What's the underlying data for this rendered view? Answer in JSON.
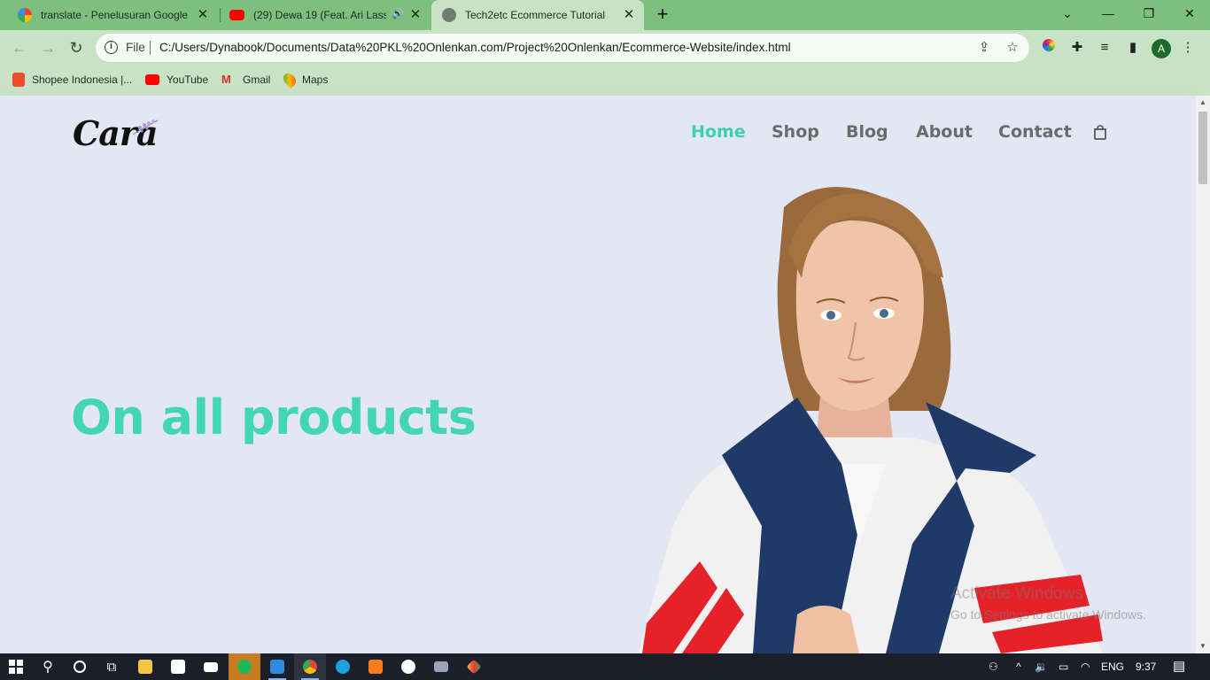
{
  "browser": {
    "tabs": [
      {
        "title": "translate - Penelusuran Google",
        "favicon": "google-icon"
      },
      {
        "title": "(29) Dewa 19 (Feat. Ari Lasso",
        "favicon": "youtube-icon"
      },
      {
        "title": "Tech2etc Ecommerce Tutorial",
        "favicon": "globe-icon"
      }
    ],
    "address": {
      "scheme": "File",
      "url": "C:/Users/Dynabook/Documents/Data%20PKL%20Onlenkan.com/Project%20Onlenkan/Ecommerce-Website/index.html"
    },
    "avatar_letter": "A",
    "bookmarks": [
      {
        "label": "Shopee Indonesia |...",
        "icon": "shopee-icon"
      },
      {
        "label": "YouTube",
        "icon": "youtube-icon"
      },
      {
        "label": "Gmail",
        "icon": "gmail-icon"
      },
      {
        "label": "Maps",
        "icon": "maps-icon"
      }
    ]
  },
  "site": {
    "logo_text": "Cara",
    "nav": [
      {
        "label": "Home",
        "active": true
      },
      {
        "label": "Shop",
        "active": false
      },
      {
        "label": "Blog",
        "active": false
      },
      {
        "label": "About",
        "active": false
      },
      {
        "label": "Contact",
        "active": false
      }
    ],
    "hero_heading": "On all products"
  },
  "overlay": {
    "line1": "Activate Windows",
    "line2": "Go to Settings to activate Windows."
  },
  "taskbar": {
    "lang": "ENG",
    "time": "9:37"
  },
  "colors": {
    "accent": "#3ecfab",
    "page_bg": "#e3e6f3",
    "tabstrip": "#7cbf7e",
    "toolbar": "#c8e2c6"
  }
}
